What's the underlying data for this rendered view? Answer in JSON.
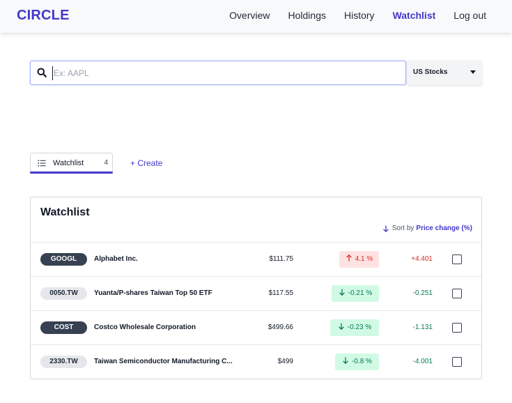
{
  "header": {
    "logo": "CIRCLE",
    "nav": [
      {
        "label": "Overview",
        "active": false
      },
      {
        "label": "Holdings",
        "active": false
      },
      {
        "label": "History",
        "active": false
      },
      {
        "label": "Watchlist",
        "active": true
      },
      {
        "label": "Log out",
        "active": false
      }
    ]
  },
  "search": {
    "placeholder": "Ex: AAPL",
    "value": "",
    "market_select": "US Stocks"
  },
  "tabs": {
    "watchlist_label": "Watchlist",
    "watchlist_count": "4",
    "create_label": "+ Create"
  },
  "card": {
    "title": "Watchlist",
    "sort_prefix": "Sort by",
    "sort_field": "Price change (%)",
    "rows": [
      {
        "ticker": "GOOGL",
        "ticker_style": "dark",
        "name": "Alphabet Inc.",
        "price": "$111.75",
        "pct": "4.1 %",
        "direction": "up",
        "change": "+4.401"
      },
      {
        "ticker": "0050.TW",
        "ticker_style": "light",
        "name": "Yuanta/P-shares Taiwan Top 50 ETF",
        "price": "$117.55",
        "pct": "-0.21 %",
        "direction": "down",
        "change": "-0.251"
      },
      {
        "ticker": "COST",
        "ticker_style": "dark",
        "name": "Costco Wholesale Corporation",
        "price": "$499.66",
        "pct": "-0.23 %",
        "direction": "down",
        "change": "-1.131"
      },
      {
        "ticker": "2330.TW",
        "ticker_style": "light",
        "name": "Taiwan Semiconductor Manufacturing C...",
        "price": "$499",
        "pct": "-0.8 %",
        "direction": "down",
        "change": "-4.001"
      }
    ]
  },
  "colors": {
    "accent": "#4338ca",
    "up": "#dc2626",
    "down": "#047857"
  }
}
